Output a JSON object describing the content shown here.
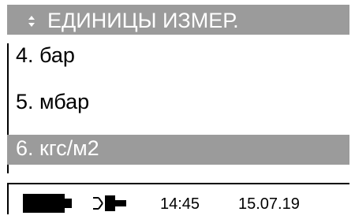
{
  "header": {
    "title": "ЕДИНИЦЫ ИЗМЕР.",
    "arrows_icon": "up-down-arrows-icon"
  },
  "menu": {
    "items": [
      {
        "label": "4. бар",
        "selected": false
      },
      {
        "label": "5. мбар",
        "selected": false
      },
      {
        "label": "6. кгс/м2",
        "selected": true
      }
    ]
  },
  "status_bar": {
    "battery_icon": "battery-icon",
    "power_icon": "power-plug-icon",
    "time": "14:45",
    "date": "15.07.19"
  },
  "colors": {
    "selected_background": "#9b9b9b",
    "header_background": "#9b9b9b",
    "text": "#000000",
    "highlight_text": "#ffffff",
    "background": "#ffffff"
  }
}
